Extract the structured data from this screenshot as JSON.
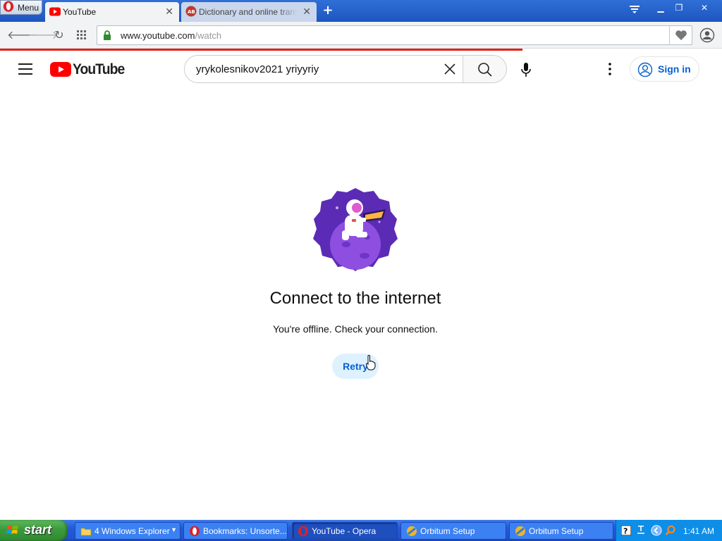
{
  "browser": {
    "menu_label": "Menu",
    "tabs": [
      {
        "title": "YouTube",
        "active": true
      },
      {
        "title": "Dictionary and online translat",
        "active": false
      }
    ],
    "new_tab": "+",
    "url_host": "www.youtube.com",
    "url_path": "/watch",
    "window_controls": [
      "minimize",
      "restore",
      "close"
    ]
  },
  "youtube": {
    "logo_text": "YouTube",
    "search_value": "yrykolesnikov2021 yriyyriy",
    "sign_in": "Sign in",
    "offline_title": "Connect to the internet",
    "offline_subtitle": "You're offline. Check your connection.",
    "retry": "Retry",
    "accent": "#065fd4",
    "brand": "#ff0000"
  },
  "taskbar": {
    "start": "start",
    "items": [
      {
        "label": "4 Windows Explorer",
        "icon": "folder-icon",
        "active": false
      },
      {
        "label": "Bookmarks: Unsorte...",
        "icon": "opera-icon",
        "active": false
      },
      {
        "label": "YouTube - Opera",
        "icon": "opera-icon",
        "active": true
      },
      {
        "label": "Orbitum Setup",
        "icon": "orbitum-icon",
        "active": false
      },
      {
        "label": "Orbitum Setup",
        "icon": "orbitum-icon",
        "active": false
      }
    ],
    "clock": "1:41 AM"
  }
}
